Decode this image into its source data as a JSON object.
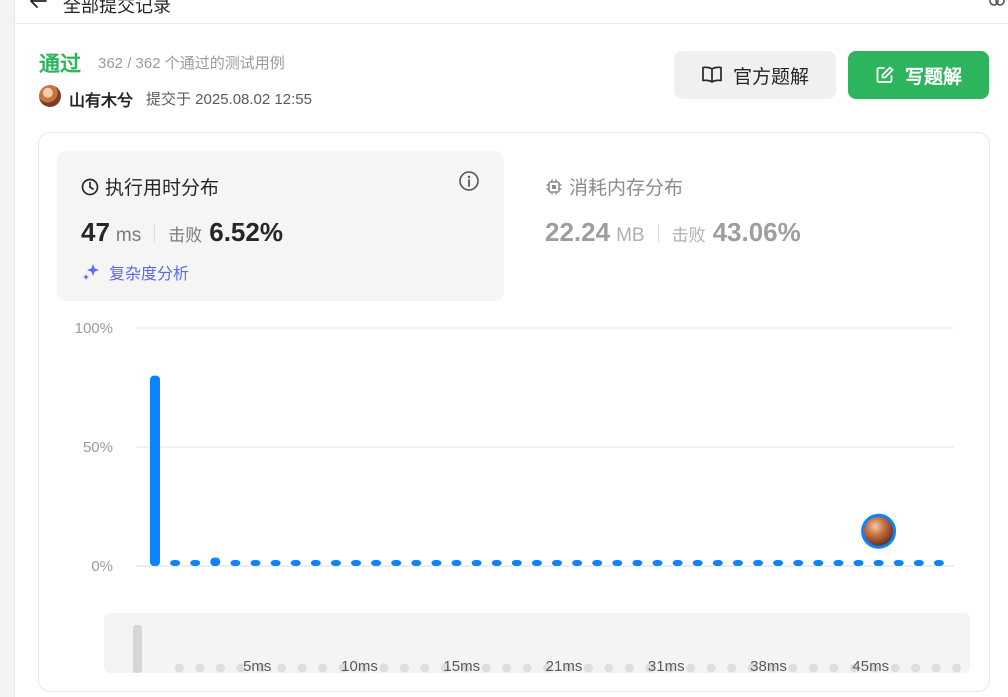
{
  "header": {
    "title": "全部提交记录"
  },
  "result": {
    "status": "通过",
    "cases": "362 / 362 个通过的测试用例",
    "user": "山有木兮",
    "submitted": "提交于 2025.08.02 12:55"
  },
  "buttons": {
    "official": "官方题解",
    "write": "写题解"
  },
  "runtime": {
    "title": "执行用时分布",
    "value": "47",
    "unit": "ms",
    "beats_label": "击败",
    "beats": "6.52%",
    "complexity": "复杂度分析"
  },
  "memory": {
    "title": "消耗内存分布",
    "value": "22.24",
    "unit": "MB",
    "beats_label": "击败",
    "beats": "43.06%"
  },
  "colors": {
    "accent": "#0a84ff",
    "green": "#2db55d",
    "grid": "#e5e5e5"
  },
  "chart_data": {
    "type": "bar",
    "y_ticks": [
      "100%",
      "50%",
      "0%"
    ],
    "ylim": [
      0,
      100
    ],
    "tick_labels": [
      "5ms",
      "10ms",
      "15ms",
      "21ms",
      "31ms",
      "38ms",
      "45ms"
    ],
    "tick_positions": [
      5,
      10,
      15,
      20,
      25,
      30,
      35
    ],
    "values": [
      80,
      2,
      2,
      3.5,
      2,
      2,
      2,
      2,
      2,
      2,
      2,
      2,
      2,
      2,
      2,
      2,
      2,
      2,
      2,
      2,
      2,
      2,
      2,
      2,
      2,
      2,
      2,
      2,
      2,
      2,
      2,
      2,
      2,
      2,
      2,
      2,
      2,
      2,
      2,
      2
    ],
    "user_bar_index": 36,
    "grid": true,
    "overview_values": [
      10,
      0,
      0,
      0,
      0,
      0,
      0,
      0,
      0,
      0,
      0,
      0,
      0,
      0,
      0,
      0,
      0,
      0,
      0,
      0,
      0,
      0,
      0,
      0,
      0,
      0,
      0,
      0,
      0,
      0,
      0,
      0,
      0,
      0,
      0,
      0,
      0,
      0,
      0,
      0
    ],
    "overview_tick_positions": [
      5,
      10,
      15,
      20,
      25,
      30,
      35
    ]
  }
}
